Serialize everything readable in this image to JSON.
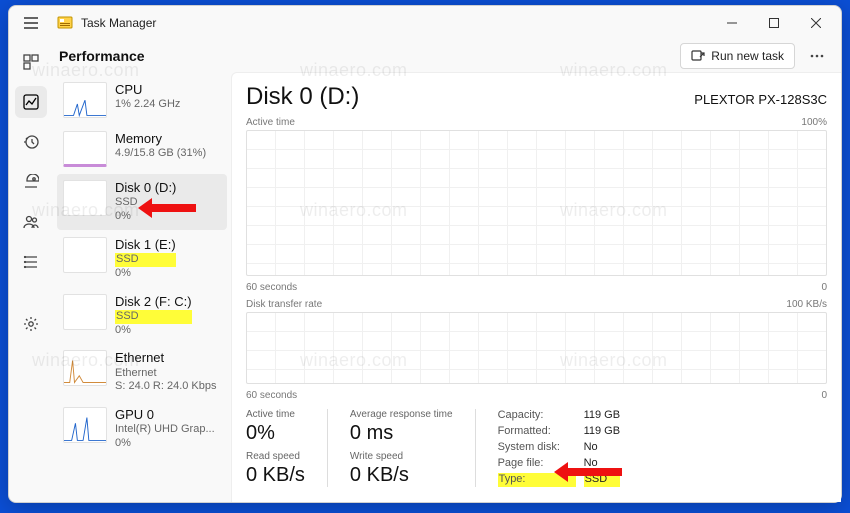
{
  "title": "Task Manager",
  "header": {
    "tab": "Performance",
    "run_task": "Run new task"
  },
  "sidebar": {
    "items": [
      {
        "name": "CPU",
        "sub": "1% 2.24 GHz",
        "selected": false,
        "thumb": "cpu"
      },
      {
        "name": "Memory",
        "sub": "4.9/15.8 GB (31%)",
        "selected": false,
        "thumb": "ram"
      },
      {
        "name": "Disk 0 (D:)",
        "sub1": "SSD",
        "sub": "0%",
        "selected": true,
        "thumb": "blank",
        "hl": false
      },
      {
        "name": "Disk 1 (E:)",
        "sub1": "SSD",
        "sub": "0%",
        "selected": false,
        "thumb": "blank",
        "hl": true
      },
      {
        "name": "Disk 2 (F: C:)",
        "sub1": "SSD",
        "sub": "0%",
        "selected": false,
        "thumb": "blank",
        "hl": true
      },
      {
        "name": "Ethernet",
        "sub": "Ethernet",
        "sub2": "S: 24.0 R: 24.0 Kbps",
        "selected": false,
        "thumb": "eth"
      },
      {
        "name": "GPU 0",
        "sub": "Intel(R) UHD Grap...",
        "sub2": "0%",
        "selected": false,
        "thumb": "gpu"
      }
    ]
  },
  "detail": {
    "name": "Disk 0 (D:)",
    "model": "PLEXTOR PX-128S3C",
    "active_label": "Active time",
    "active_max": "100%",
    "x_left": "60 seconds",
    "x_right": "0",
    "transfer_label": "Disk transfer rate",
    "transfer_max": "100 KB/s",
    "stats": {
      "active_label": "Active time",
      "active": "0%",
      "resp_label": "Average response time",
      "resp": "0 ms",
      "read_label": "Read speed",
      "read": "0 KB/s",
      "write_label": "Write speed",
      "write": "0 KB/s"
    },
    "kv": {
      "capacity_k": "Capacity:",
      "capacity_v": "119 GB",
      "formatted_k": "Formatted:",
      "formatted_v": "119 GB",
      "sysdisk_k": "System disk:",
      "sysdisk_v": "No",
      "pagefile_k": "Page file:",
      "pagefile_v": "No",
      "type_k": "Type:",
      "type_v": "SSD"
    }
  },
  "watermark": "winaero.com"
}
